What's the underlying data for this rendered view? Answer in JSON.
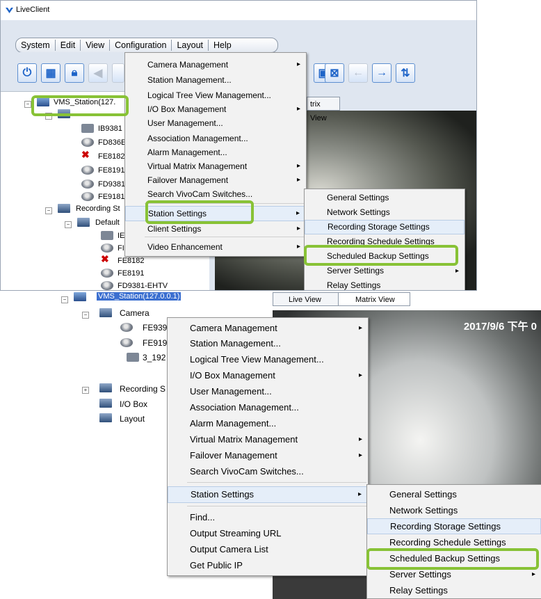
{
  "window": {
    "title": "LiveClient"
  },
  "menubar": [
    "System",
    "Edit",
    "View",
    "Configuration",
    "Layout",
    "Help"
  ],
  "config_menu_top": [
    {
      "label": "Camera Management",
      "sub": true
    },
    {
      "label": "Station Management...",
      "sub": false
    },
    {
      "label": "Logical Tree View Management...",
      "sub": false
    },
    {
      "label": "I/O Box Management",
      "sub": true
    },
    {
      "label": "User Management...",
      "sub": false
    },
    {
      "label": "Association Management...",
      "sub": false
    },
    {
      "label": "Alarm Management...",
      "sub": false
    },
    {
      "label": "Virtual Matrix Management",
      "sub": true
    },
    {
      "label": "Failover Management",
      "sub": true
    },
    {
      "label": "Search VivoCam Switches...",
      "sub": false
    },
    {
      "label": "Station Settings",
      "sub": true
    },
    {
      "label": "Client Settings",
      "sub": true
    },
    {
      "label": "Video Enhancement",
      "sub": true
    }
  ],
  "context_menu_bottom": [
    {
      "label": "Camera Management",
      "sub": true
    },
    {
      "label": "Station Management...",
      "sub": false
    },
    {
      "label": "Logical Tree View Management...",
      "sub": false
    },
    {
      "label": "I/O Box Management",
      "sub": true
    },
    {
      "label": "User Management...",
      "sub": false
    },
    {
      "label": "Association Management...",
      "sub": false
    },
    {
      "label": "Alarm Management...",
      "sub": false
    },
    {
      "label": "Virtual Matrix Management",
      "sub": true
    },
    {
      "label": "Failover Management",
      "sub": true
    },
    {
      "label": "Search VivoCam Switches...",
      "sub": false
    },
    {
      "label": "Station Settings",
      "sub": true
    },
    {
      "label": "Find...",
      "sub": false
    },
    {
      "label": "Output Streaming URL",
      "sub": false
    },
    {
      "label": "Output Camera List",
      "sub": false
    },
    {
      "label": "Get Public IP",
      "sub": false
    }
  ],
  "station_settings_submenu": [
    {
      "label": "General Settings",
      "sub": false
    },
    {
      "label": "Network Settings",
      "sub": false
    },
    {
      "label": "Recording Storage Settings",
      "sub": false
    },
    {
      "label": "Recording Schedule Settings",
      "sub": false
    },
    {
      "label": "Scheduled Backup Settings",
      "sub": false
    },
    {
      "label": "Server Settings",
      "sub": true
    },
    {
      "label": "Relay Settings",
      "sub": false
    }
  ],
  "tree_top": {
    "station": "VMS_Station(127.",
    "cameras": [
      "IB9381",
      "FD836E",
      "FE8182",
      "FE8191",
      "FD9381",
      "FE9181"
    ],
    "recording": "Recording St",
    "default": "Default",
    "rec_cameras": [
      "IE",
      "FI",
      "FE8182",
      "FE8191",
      "FD9381-EHTV"
    ]
  },
  "tree_bottom": {
    "station": "VMS_Station(127.0.0.1)",
    "camera_folder": "Camera",
    "cameras": [
      "FE939",
      "FE919",
      "3_192"
    ],
    "recording": "Recording S",
    "io_box": "I/O Box",
    "layout": "Layout"
  },
  "tabs_top": {
    "matrix": "trix View"
  },
  "tabs_bottom": {
    "live": "Live View",
    "matrix": "Matrix View"
  },
  "video_bottom": {
    "timestamp": "2017/9/6 下午 0"
  },
  "colors": {
    "highlight": "#88c236",
    "accent": "#1e64c8"
  }
}
